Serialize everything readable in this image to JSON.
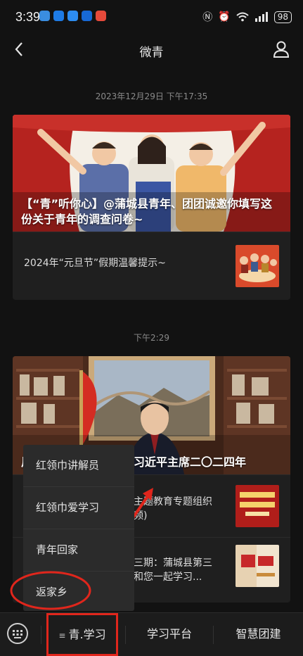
{
  "status": {
    "time": "3:39",
    "battery": "98"
  },
  "nav": {
    "title": "微青"
  },
  "feed": {
    "ts1": "2023年12月29日 下午17:35",
    "card1": {
      "title": "【“青”听你心】@蒲城县青年、团团诚邀你填写这份关于青年的调查问卷~",
      "sub": "2024年“元旦节”假期温馨提示~"
    },
    "ts2": "下午2:29",
    "card2": {
      "title": "风雨之后见彩虹，读懂习近平主席二〇二四年",
      "row1": "主题教育专题组织\n频)",
      "row2": "三期：蒲城县第三\n和您一起学习..."
    }
  },
  "menu": {
    "items": [
      "红领巾讲解员",
      "红领巾爱学习",
      "青年回家",
      "返家乡"
    ]
  },
  "bottom": {
    "tab1": "青.学习",
    "tab2": "学习平台",
    "tab3": "智慧团建"
  },
  "colors": {
    "accent_red": "#e0261c",
    "background": "#121212"
  }
}
